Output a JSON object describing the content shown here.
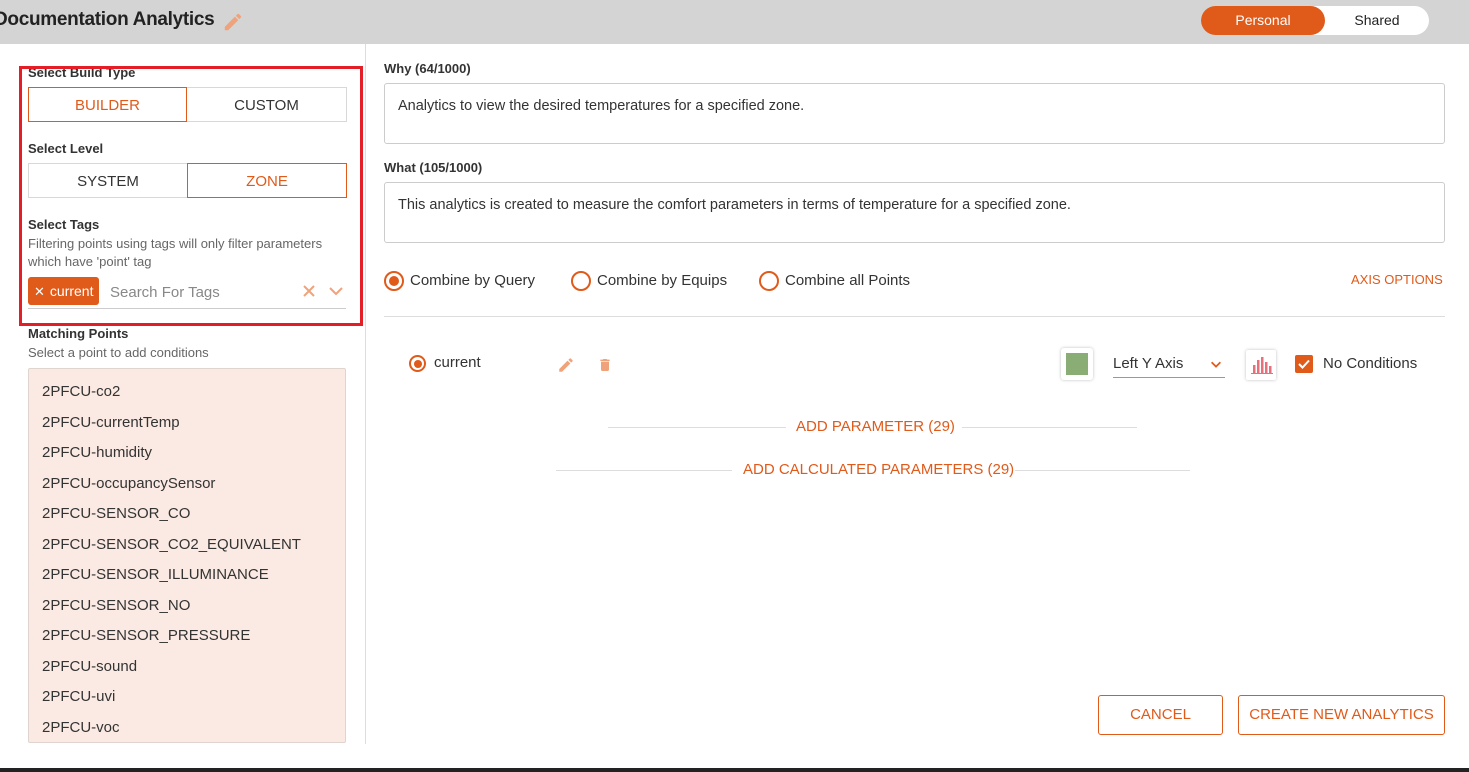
{
  "header": {
    "title": "Documentation Analytics",
    "toggle": {
      "personal": "Personal",
      "shared": "Shared",
      "selected": "Personal"
    }
  },
  "build": {
    "type_label": "Select Build Type",
    "type_options": [
      "BUILDER",
      "CUSTOM"
    ],
    "type_selected": "BUILDER",
    "level_label": "Select Level",
    "level_options": [
      "SYSTEM",
      "ZONE"
    ],
    "level_selected": "ZONE",
    "tags_label": "Select Tags",
    "tags_help": "Filtering points using tags will only filter parameters which have 'point' tag",
    "tags": [
      "current"
    ],
    "tags_placeholder": "Search For Tags"
  },
  "matching": {
    "label": "Matching Points",
    "help": "Select a point to add conditions",
    "points": [
      "2PFCU-co2",
      "2PFCU-currentTemp",
      "2PFCU-humidity",
      "2PFCU-occupancySensor",
      "2PFCU-SENSOR_CO",
      "2PFCU-SENSOR_CO2_EQUIVALENT",
      "2PFCU-SENSOR_ILLUMINANCE",
      "2PFCU-SENSOR_NO",
      "2PFCU-SENSOR_PRESSURE",
      "2PFCU-sound",
      "2PFCU-uvi",
      "2PFCU-voc"
    ]
  },
  "form": {
    "why_label": "Why (64/1000)",
    "why_value": "Analytics to view the desired temperatures for a specified zone.",
    "what_label": "What (105/1000)",
    "what_value": "This analytics is created to measure the comfort parameters in terms of temperature for a specified zone."
  },
  "combine": {
    "options": [
      "Combine by Query",
      "Combine by Equips",
      "Combine all Points"
    ],
    "selected": "Combine by Query",
    "axis_options": "AXIS OPTIONS"
  },
  "parameter": {
    "name": "current",
    "color": "#8aad75",
    "axis": "Left Y Axis",
    "no_conditions_label": "No Conditions",
    "no_conditions_checked": true,
    "add_parameter": "ADD PARAMETER (29)",
    "add_calculated": "ADD CALCULATED PARAMETERS (29)"
  },
  "actions": {
    "cancel": "CANCEL",
    "create": "CREATE NEW ANALYTICS"
  },
  "colors": {
    "accent": "#e05a1a",
    "highlight_box": "#e41e26",
    "list_bg": "#fbeae3"
  },
  "icons": [
    "pencil-icon",
    "close-icon",
    "chevron-down-icon",
    "trash-icon",
    "bar-chart-icon",
    "checkbox-checked-icon"
  ]
}
